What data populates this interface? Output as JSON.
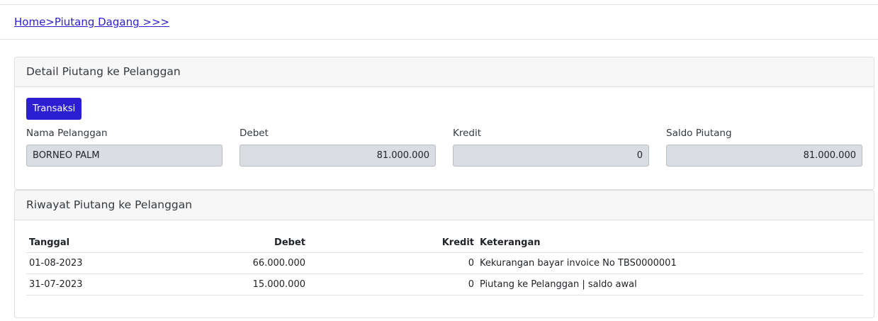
{
  "breadcrumb": {
    "home": "Home",
    "current": ">Piutang Dagang >>>"
  },
  "detail_card": {
    "title": "Detail Piutang ke Pelanggan",
    "button_label": "Transaksi",
    "fields": {
      "nama_label": "Nama Pelanggan",
      "nama_value": "BORNEO PALM",
      "debet_label": "Debet",
      "debet_value": "81.000.000",
      "kredit_label": "Kredit",
      "kredit_value": "0",
      "saldo_label": "Saldo Piutang",
      "saldo_value": "81.000.000"
    }
  },
  "history_card": {
    "title": "Riwayat Piutang ke Pelanggan",
    "columns": {
      "tanggal": "Tanggal",
      "debet": "Debet",
      "kredit": "Kredit",
      "keterangan": "Keterangan"
    },
    "rows": [
      {
        "tanggal": "01-08-2023",
        "debet": "66.000.000",
        "kredit": "0",
        "keterangan": "Kekurangan bayar invoice No TBS0000001"
      },
      {
        "tanggal": "31-07-2023",
        "debet": "15.000.000",
        "kredit": "0",
        "keterangan": "Piutang ke Pelanggan | saldo awal"
      }
    ]
  },
  "colors": {
    "accent": "#2b1fd1",
    "input_bg": "#d9dce1",
    "header_bg": "#f7f7f7"
  }
}
